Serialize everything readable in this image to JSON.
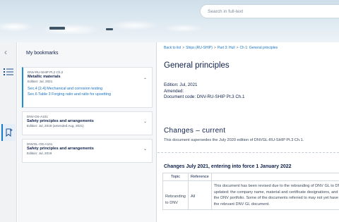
{
  "header": {
    "search_placeholder": "Search in full-text"
  },
  "rail": {
    "collapse_icon": "chevron-left-icon",
    "toc_icon": "list-icon",
    "bookmark_icon": "bookmark-icon"
  },
  "bookmarks": {
    "title": "My bookmarks",
    "cards": [
      {
        "code": "DNV-RU-SHIP Pt.2 Ch.2",
        "name": "Metallic materials",
        "edition": "Edition: Jul, 2021",
        "links": [
          "Sec.4 [2.4] Mechanical and corrosion testing",
          "Sec.6 Table 3 Forging ratio and ratio for upsetting"
        ]
      },
      {
        "code": "DNV-OS-A101",
        "name": "Safety principles and arrangements",
        "edition": "Edition: Jul, 2019 (amended Aug, 2021)"
      },
      {
        "code": "DNVGL-OS-A101",
        "name": "Safety principles and arrangements",
        "edition": "Edition: Jul, 2019"
      }
    ]
  },
  "content": {
    "breadcrumb": [
      "Back to list",
      "Ships (RU-SHIP)",
      "Part 3: Hull",
      "Ch 1: General principles"
    ],
    "title": "General principles",
    "edition": "Edition: Jul, 2021",
    "amended": "Amended:",
    "doc_code": "Document code: DNV-RU-SHIP Pt.3 Ch.1",
    "changes_heading": "Changes – current",
    "supersede_text": "This document supersedes the July 2020 edition of DNVGL-RU-SHIP Pt.3 Ch.1.",
    "changes_subheading": "Changes July 2021, entering into force 1 January 2022",
    "table": {
      "headers": [
        "Topic",
        "Reference",
        ""
      ],
      "rows": [
        {
          "topic": "Rebranding to DNV",
          "reference": "All",
          "description_lines": [
            "This document has been revised due to the rebranding of DNV GL to DNV. The following have been",
            "updated: the company name, material and certificate designations, and references to other documents in",
            "the DNV portfolio. Some of the documents referred to may not yet have been rebranded. If so, please see",
            "the relevant DNV GL document."
          ]
        }
      ]
    }
  }
}
